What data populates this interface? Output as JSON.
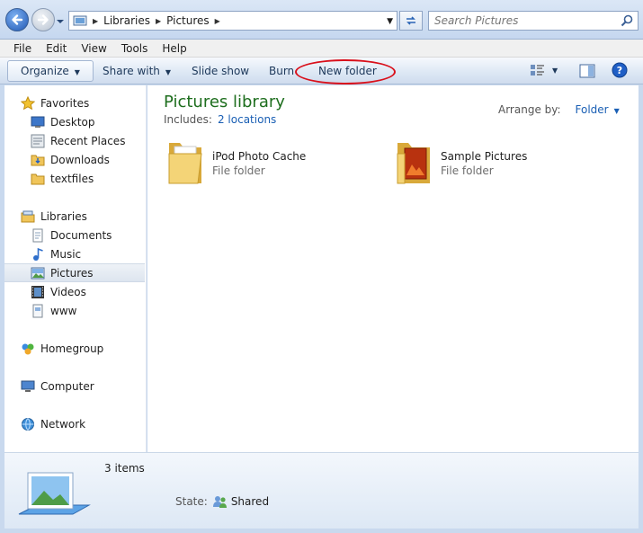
{
  "address": {
    "crumbs": [
      "Libraries",
      "Pictures"
    ]
  },
  "search": {
    "placeholder": "Search Pictures"
  },
  "menu": [
    "File",
    "Edit",
    "View",
    "Tools",
    "Help"
  ],
  "commands": {
    "organize": "Organize",
    "share_with": "Share with",
    "slide_show": "Slide show",
    "burn": "Burn",
    "new_folder": "New folder"
  },
  "sidebar": {
    "favorites": {
      "label": "Favorites",
      "items": [
        "Desktop",
        "Recent Places",
        "Downloads",
        "textfiles"
      ]
    },
    "libraries": {
      "label": "Libraries",
      "items": [
        "Documents",
        "Music",
        "Pictures",
        "Videos",
        "www"
      ]
    },
    "homegroup": "Homegroup",
    "computer": "Computer",
    "network": "Network"
  },
  "main": {
    "title": "Pictures library",
    "includes_label": "Includes:",
    "locations_link": "2 locations",
    "arrange_label": "Arrange by:",
    "arrange_value": "Folder",
    "items": [
      {
        "name": "iPod Photo Cache",
        "type": "File folder"
      },
      {
        "name": "Sample Pictures",
        "type": "File folder"
      }
    ]
  },
  "details": {
    "count": "3 items",
    "state_label": "State:",
    "state_value": "Shared"
  },
  "colors": {
    "annotation_ring": "#d9101b",
    "link": "#1a5fb4",
    "title": "#1e6e1e"
  }
}
